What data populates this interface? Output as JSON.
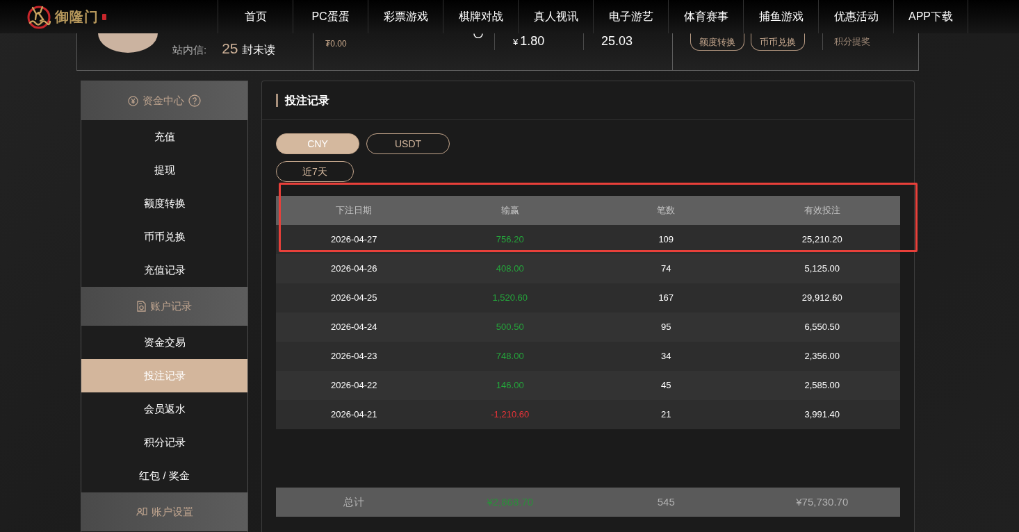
{
  "header": {
    "logo": {
      "text": "御隆门"
    },
    "nav": [
      {
        "label": "首页"
      },
      {
        "label": "PC蛋蛋"
      },
      {
        "label": "彩票游戏"
      },
      {
        "label": "棋牌对战"
      },
      {
        "label": "真人视讯"
      },
      {
        "label": "电子游艺"
      },
      {
        "label": "体育赛事"
      },
      {
        "label": "捕鱼游戏"
      },
      {
        "label": "优惠活动"
      },
      {
        "label": "APP下载"
      }
    ]
  },
  "account": {
    "messages_label": "站内信:",
    "unread_count": "25",
    "unread_suffix": "封未读",
    "usdt_balance": "₮0.00",
    "balance_symbol": "¥",
    "balance": "1.80",
    "amount_2": "25.03",
    "buttons": [
      "额度转换",
      "币币兑换"
    ],
    "points_label": "积分提奖"
  },
  "sidebar": {
    "sections": [
      {
        "title": "资金中心",
        "help": true,
        "items": [
          {
            "label": "充值",
            "selected": false
          },
          {
            "label": "提现",
            "selected": false
          },
          {
            "label": "额度转换",
            "selected": false
          },
          {
            "label": "币币兑换",
            "selected": false
          },
          {
            "label": "充值记录",
            "selected": false
          }
        ]
      },
      {
        "title": "账户记录",
        "help": false,
        "items": [
          {
            "label": "资金交易",
            "selected": false
          },
          {
            "label": "投注记录",
            "selected": true
          },
          {
            "label": "会员返水",
            "selected": false
          },
          {
            "label": "积分记录",
            "selected": false
          },
          {
            "label": "红包 / 奖金",
            "selected": false
          }
        ]
      },
      {
        "title": "账户设置",
        "help": false
      }
    ]
  },
  "content": {
    "title": "投注记录",
    "currency_tabs": [
      {
        "label": "CNY",
        "selected": true
      },
      {
        "label": "USDT",
        "selected": false
      }
    ],
    "period_filter": "近7天",
    "table": {
      "highlight_frame": true,
      "columns": [
        "下注日期",
        "输赢",
        "笔数",
        "有效投注"
      ],
      "rows": [
        {
          "date": "2026-04-27",
          "win_loss": "756.20",
          "color": "#24a63b",
          "bets": "109",
          "valid_bet": "25,210.20"
        },
        {
          "date": "2026-04-26",
          "win_loss": "408.00",
          "color": "#24a63b",
          "bets": "74",
          "valid_bet": "5,125.00"
        },
        {
          "date": "2026-04-25",
          "win_loss": "1,520.60",
          "color": "#24a63b",
          "bets": "167",
          "valid_bet": "29,912.60"
        },
        {
          "date": "2026-04-24",
          "win_loss": "500.50",
          "color": "#24a63b",
          "bets": "95",
          "valid_bet": "6,550.50"
        },
        {
          "date": "2026-04-23",
          "win_loss": "748.00",
          "color": "#24a63b",
          "bets": "34",
          "valid_bet": "2,356.00"
        },
        {
          "date": "2026-04-22",
          "win_loss": "146.00",
          "color": "#24a63b",
          "bets": "45",
          "valid_bet": "2,585.00"
        },
        {
          "date": "2026-04-21",
          "win_loss": "-1,210.60",
          "color": "#ea3338",
          "bets": "21",
          "valid_bet": "3,991.40"
        }
      ],
      "total": {
        "label": "总计",
        "win_loss": "¥2,868.70",
        "color": "#2b8d3a",
        "bets": "545",
        "valid_bet": "¥75,730.70"
      }
    }
  }
}
